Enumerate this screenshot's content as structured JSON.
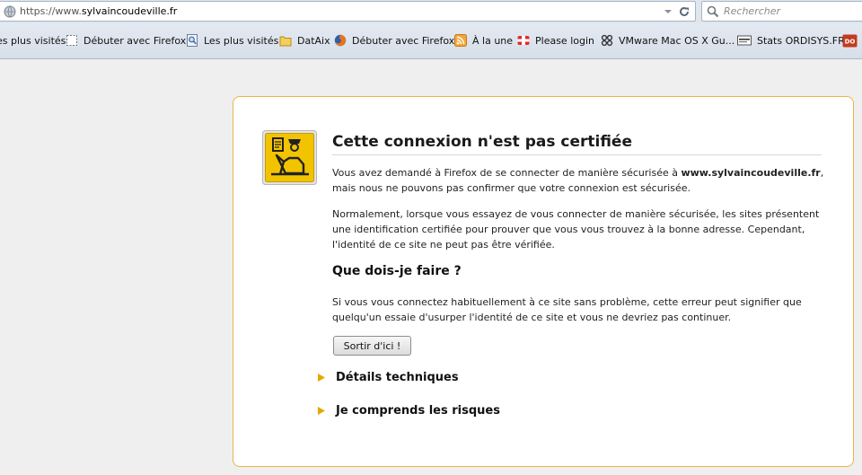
{
  "urlbar": {
    "protocol": "https://www.",
    "host": "sylvaincoudeville.fr",
    "search_placeholder": "Rechercher"
  },
  "bookmarks": [
    {
      "label": "es plus visités",
      "icon": "none"
    },
    {
      "label": "Débuter avec Firefox",
      "icon": "dashed-page-icon"
    },
    {
      "label": "Les plus visités",
      "icon": "magnifier-page-icon"
    },
    {
      "label": "DatAix",
      "icon": "folder-icon"
    },
    {
      "label": "Débuter avec Firefox",
      "icon": "firefox-icon"
    },
    {
      "label": "À la une",
      "icon": "rss-icon"
    },
    {
      "label": "Please login",
      "icon": "fortinet-icon"
    },
    {
      "label": "VMware Mac OS X Gu...",
      "icon": "vmware-icon"
    },
    {
      "label": "Stats ORDISYS.FR",
      "icon": "ordisys-icon"
    },
    {
      "label": "",
      "icon": "do-icon"
    }
  ],
  "error_page": {
    "title": "Cette connexion n'est pas certifiée",
    "p1_before": "Vous avez demandé à Firefox de se connecter de manière sécurisée à ",
    "p1_host": "www.sylvaincoudeville.fr",
    "p1_after": ", mais nous ne pouvons pas confirmer que votre connexion est sécurisée.",
    "p2": "Normalement, lorsque vous essayez de vous connecter de manière sécurisée, les sites présentent une identification certifiée pour prouver que vous vous trouvez à la bonne adresse. Cependant, l'identité de ce site ne peut pas être vérifiée.",
    "subtitle": "Que dois-je faire ?",
    "p3": "Si vous vous connectez habituellement à ce site sans problème, cette erreur peut signifier que quelqu'un essaie d'usurper l'identité de ce site et vous ne devriez pas continuer.",
    "leave_button": "Sortir d'ici !",
    "tech_details": "Détails techniques",
    "understand_risks": "Je comprends les risques"
  },
  "colors": {
    "card_border": "#e7b64a",
    "expander_triangle": "#e5a800",
    "icon_yellow": "#f2c400"
  }
}
